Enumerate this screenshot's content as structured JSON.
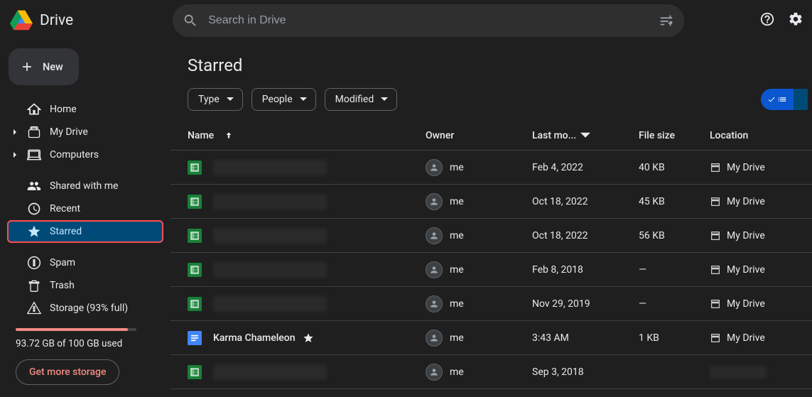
{
  "brand": {
    "name": "Drive"
  },
  "search": {
    "placeholder": "Search in Drive"
  },
  "sidebar": {
    "new_label": "New",
    "items": [
      {
        "label": "Home"
      },
      {
        "label": "My Drive"
      },
      {
        "label": "Computers"
      },
      {
        "label": "Shared with me"
      },
      {
        "label": "Recent"
      },
      {
        "label": "Starred"
      },
      {
        "label": "Spam"
      },
      {
        "label": "Trash"
      },
      {
        "label": "Storage (93% full)"
      }
    ],
    "storage_used": "93.72 GB of 100 GB used",
    "get_storage": "Get more storage"
  },
  "page": {
    "title": "Starred"
  },
  "filters": {
    "type": "Type",
    "people": "People",
    "modified": "Modified"
  },
  "columns": {
    "name": "Name",
    "owner": "Owner",
    "lastmod": "Last mo...",
    "filesize": "File size",
    "location": "Location"
  },
  "rows": [
    {
      "kind": "sheet",
      "name": null,
      "owner": "me",
      "lastmod": "Feb 4, 2022",
      "size": "40 KB",
      "location": "My Drive"
    },
    {
      "kind": "sheet",
      "name": null,
      "owner": "me",
      "lastmod": "Oct 18, 2022",
      "size": "45 KB",
      "location": "My Drive"
    },
    {
      "kind": "sheet",
      "name": null,
      "owner": "me",
      "lastmod": "Oct 18, 2022",
      "size": "56 KB",
      "location": "My Drive"
    },
    {
      "kind": "sheet",
      "name": null,
      "owner": "me",
      "lastmod": "Feb 8, 2018",
      "size": "—",
      "location": "My Drive"
    },
    {
      "kind": "sheet",
      "name": null,
      "owner": "me",
      "lastmod": "Nov 29, 2019",
      "size": "—",
      "location": "My Drive"
    },
    {
      "kind": "doc",
      "name": "Karma Chameleon",
      "starred": true,
      "owner": "me",
      "lastmod": "3:43 AM",
      "size": "1 KB",
      "location": "My Drive"
    },
    {
      "kind": "sheet",
      "name": null,
      "owner": "me",
      "lastmod": "Sep 3, 2018",
      "size": "",
      "location": null
    }
  ]
}
